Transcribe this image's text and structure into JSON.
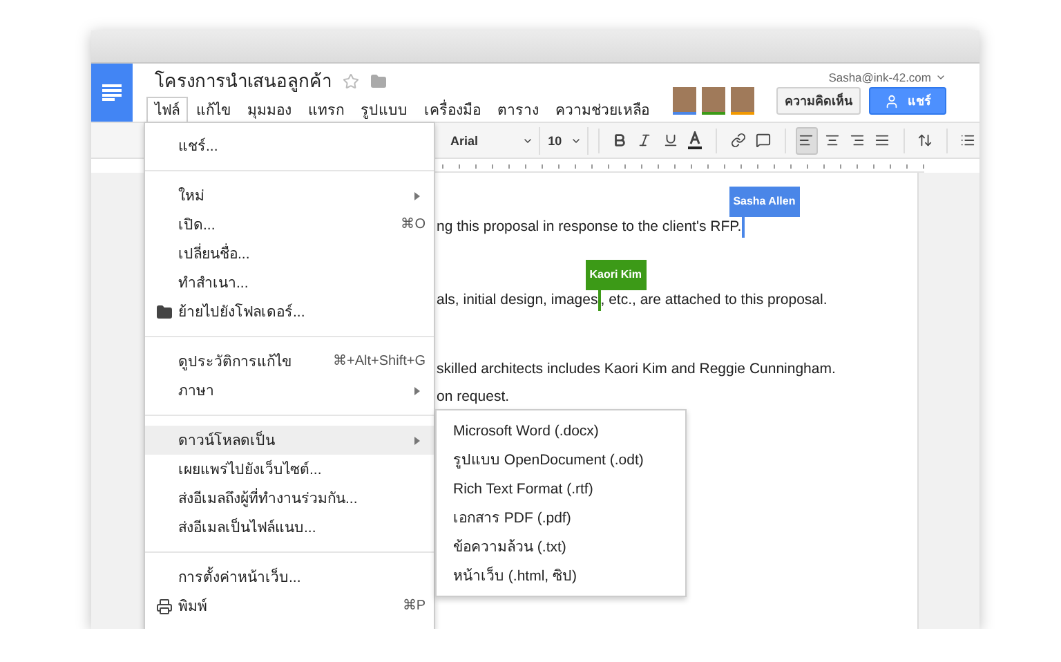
{
  "header": {
    "title": "โครงการนำเสนอลูกค้า",
    "account": "Sasha@ink-42.com",
    "comment_button": "ความคิดเห็น",
    "share_button": "แชร์",
    "collaborators": [
      {
        "color": "#4a86e8"
      },
      {
        "color": "#3c9a17"
      },
      {
        "color": "#f29900"
      }
    ]
  },
  "menu_bar": [
    {
      "label": "ไฟล์",
      "selected": true
    },
    {
      "label": "แก้ไข",
      "selected": false
    },
    {
      "label": "มุมมอง",
      "selected": false
    },
    {
      "label": "แทรก",
      "selected": false
    },
    {
      "label": "รูปแบบ",
      "selected": false
    },
    {
      "label": "เครื่องมือ",
      "selected": false
    },
    {
      "label": "ตาราง",
      "selected": false
    },
    {
      "label": "ความช่วยเหลือ",
      "selected": false
    }
  ],
  "toolbar": {
    "font": "Arial",
    "size": "10",
    "alignments": [
      {
        "selected": true
      },
      {
        "selected": false
      },
      {
        "selected": false
      },
      {
        "selected": false
      }
    ]
  },
  "document": {
    "lines": [
      {
        "text": "ng this proposal in response to the client's RFP.",
        "cursor": {
          "name": "Sasha Allen",
          "color": "#4a86e8"
        }
      },
      {
        "text": "als, initial design, images",
        "cursor": {
          "name": "Kaori Kim",
          "color": "#3c9a17"
        },
        "after": ", etc., are attached to this proposal."
      },
      {
        "text": "skilled architects includes Kaori Kim and Reggie Cunningham."
      },
      {
        "text": "on request."
      }
    ]
  },
  "file_menu": {
    "sections": [
      [
        {
          "label": "แชร์...",
          "kind": "text",
          "selected": false
        }
      ],
      [
        {
          "label": "ใหม่",
          "kind": "text",
          "submenu": true,
          "selected": false
        },
        {
          "label": "เปิด...",
          "kind": "text",
          "shortcut": "⌘O",
          "selected": false
        },
        {
          "label": "เปลี่ยนชื่อ...",
          "kind": "text",
          "selected": false
        },
        {
          "label": "ทำสำเนา...",
          "kind": "text",
          "selected": false
        },
        {
          "label": "ย้ายไปยังโฟลเดอร์...",
          "kind": "folder",
          "selected": false
        }
      ],
      [
        {
          "label": "ดูประวัติการแก้ไข",
          "kind": "text",
          "shortcut": "⌘+Alt+Shift+G",
          "selected": false
        },
        {
          "label": "ภาษา",
          "kind": "text",
          "submenu": true,
          "selected": false
        }
      ],
      [
        {
          "label": "ดาวน์โหลดเป็น",
          "kind": "text",
          "submenu": true,
          "selected": true
        },
        {
          "label": "เผยแพร่ไปยังเว็บไซต์...",
          "kind": "text",
          "selected": false
        },
        {
          "label": "ส่งอีเมลถึงผู้ที่ทำงานร่วมกัน...",
          "kind": "text",
          "selected": false
        },
        {
          "label": "ส่งอีเมลเป็นไฟล์แนบ...",
          "kind": "text",
          "selected": false
        }
      ],
      [
        {
          "label": "การตั้งค่าหน้าเว็บ...",
          "kind": "text",
          "selected": false
        },
        {
          "label": "พิมพ์",
          "kind": "printer",
          "shortcut": "⌘P",
          "selected": false
        }
      ]
    ]
  },
  "download_menu": [
    {
      "label": "Microsoft Word (.docx)",
      "selected": false
    },
    {
      "label": "รูปแบบ OpenDocument (.odt)",
      "selected": false
    },
    {
      "label": "Rich Text Format (.rtf)",
      "selected": false
    },
    {
      "label": "เอกสาร PDF (.pdf)",
      "selected": false
    },
    {
      "label": "ข้อความล้วน (.txt)",
      "selected": false
    },
    {
      "label": "หน้าเว็บ (.html, ซิป)",
      "selected": false
    }
  ]
}
